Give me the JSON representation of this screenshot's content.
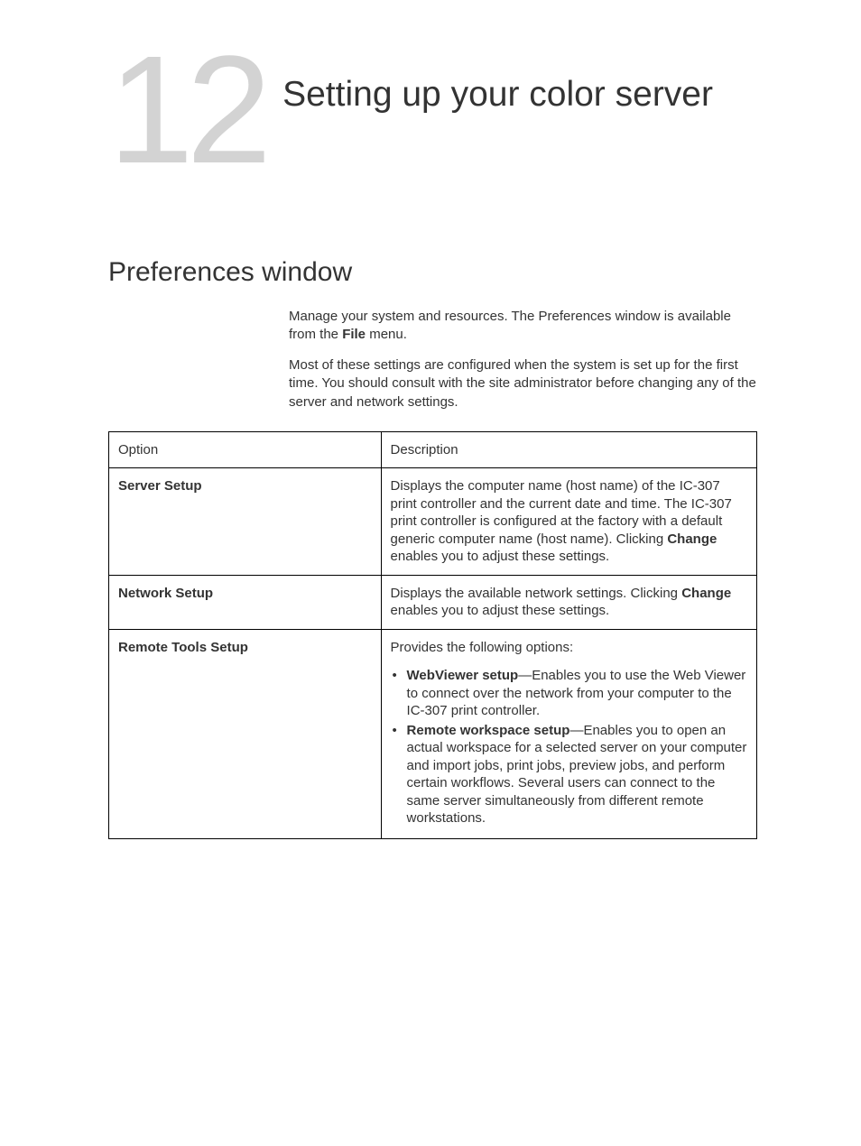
{
  "chapter": {
    "number": "12",
    "title": "Setting up your color server"
  },
  "section": {
    "title": "Preferences window",
    "intro1_a": "Manage your system and resources. The Preferences window is available from the ",
    "intro1_bold": "File",
    "intro1_b": " menu.",
    "intro2": "Most of these settings are configured when the system is set up for the first time. You should consult with the site administrator before changing any of the server and network settings."
  },
  "table": {
    "headers": {
      "option": "Option",
      "description": "Description"
    },
    "rows": {
      "server_setup": {
        "option": "Server Setup",
        "desc_a": "Displays the computer name (host name) of the IC-307 print controller and the current date and time. The IC-307 print controller is configured at the factory with a default generic computer name (host name). Clicking ",
        "desc_bold": "Change",
        "desc_b": " enables you to adjust these settings."
      },
      "network_setup": {
        "option": "Network Setup",
        "desc_a": "Displays the available network settings. Clicking ",
        "desc_bold": "Change",
        "desc_b": " enables you to adjust these settings."
      },
      "remote_tools": {
        "option": "Remote Tools Setup",
        "intro": "Provides the following options:",
        "item1_bold": "WebViewer setup",
        "item1_rest": "—Enables you to use the Web Viewer to connect over the network from your computer to the IC-307 print controller.",
        "item2_bold": "Remote workspace setup",
        "item2_rest": "—Enables you to open an actual workspace for a selected server on your computer and import jobs, print jobs, preview jobs, and perform certain workflows. Several users can connect to the same server simultaneously from different remote workstations."
      }
    }
  }
}
